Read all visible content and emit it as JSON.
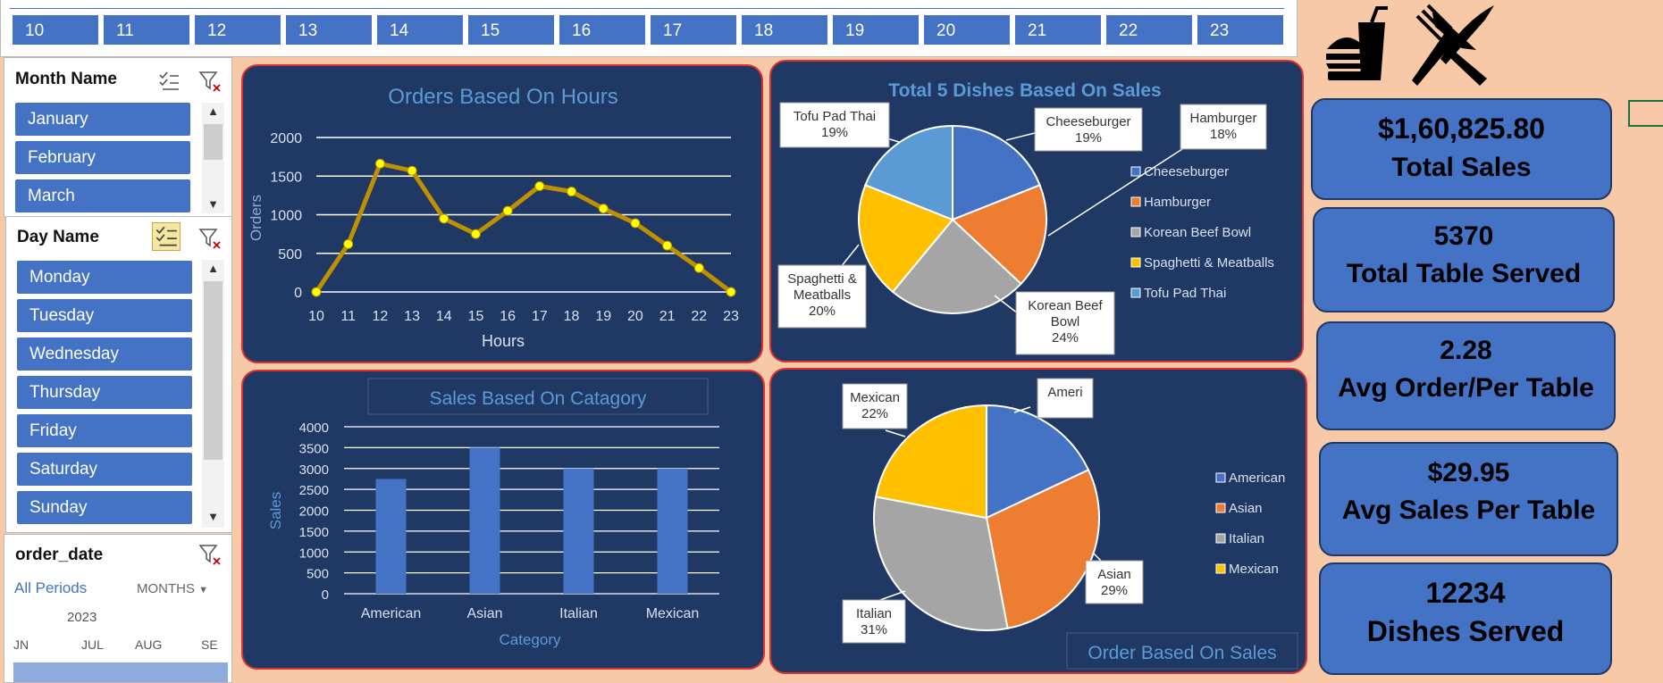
{
  "hour_slicer": {
    "hours": [
      "10",
      "11",
      "12",
      "13",
      "14",
      "15",
      "16",
      "17",
      "18",
      "19",
      "20",
      "21",
      "22",
      "23"
    ]
  },
  "month_slicer": {
    "title": "Month Name",
    "items": [
      "January",
      "February",
      "March"
    ]
  },
  "day_slicer": {
    "title": "Day Name",
    "items": [
      "Monday",
      "Tuesday",
      "Wednesday",
      "Thursday",
      "Friday",
      "Saturday",
      "Sunday"
    ]
  },
  "timeline": {
    "title": "order_date",
    "all_periods": "All Periods",
    "unit": "MONTHS",
    "year": "2023",
    "months": [
      "JN",
      "JUL",
      "AUG",
      "SE"
    ]
  },
  "kpis": [
    {
      "value": "$1,60,825.80",
      "label": "Total Sales"
    },
    {
      "value": "5370",
      "label": "Total Table Served"
    },
    {
      "value": "2.28",
      "label": "Avg Order/Per Table"
    },
    {
      "value": "$29.95",
      "label": "Avg Sales Per Table"
    },
    {
      "value": "12234",
      "label": "Dishes Served"
    }
  ],
  "colors": {
    "background": "#f8c9a6",
    "panel": "#203864",
    "panel_border": "#e03030",
    "accent": "#4472c4",
    "line": "#bf9000",
    "point": "#ffff00"
  },
  "icons": [
    "burger-drink-icon",
    "fork-knife-icon"
  ],
  "chart_data": [
    {
      "type": "line",
      "title": "Orders Based On Hours",
      "xlabel": "Hours",
      "ylabel": "Orders",
      "x": [
        10,
        11,
        12,
        13,
        14,
        15,
        16,
        17,
        18,
        19,
        20,
        21,
        22,
        23
      ],
      "y": [
        0,
        620,
        1660,
        1570,
        950,
        750,
        1050,
        1370,
        1300,
        1080,
        890,
        600,
        310,
        0
      ],
      "ylim": [
        0,
        2000
      ],
      "yticks": [
        0,
        500,
        1000,
        1500,
        2000
      ],
      "grid": true
    },
    {
      "type": "pie",
      "title": "Total 5 Dishes Based On Sales",
      "labels": [
        "Cheeseburger",
        "Hamburger",
        "Korean Beef Bowl",
        "Spaghetti & Meatballs",
        "Tofu Pad Thai"
      ],
      "values": [
        19,
        18,
        24,
        20,
        19
      ],
      "colors": [
        "#4472c4",
        "#ed7d31",
        "#a5a5a5",
        "#ffc000",
        "#5b9bd5"
      ],
      "callouts": [
        "Cheeseburger 19%",
        "Hamburger 18%",
        "Korean Beef Bowl 24%",
        "Spaghetti & Meatballs 20%",
        "Tofu Pad Thai 19%"
      ],
      "legend": "right"
    },
    {
      "type": "bar",
      "title": "Sales Based On Catagory",
      "xlabel": "Category",
      "ylabel": "Sales",
      "categories": [
        "American",
        "Asian",
        "Italian",
        "Mexican"
      ],
      "values": [
        2750,
        3500,
        3000,
        3000
      ],
      "ylim": [
        0,
        4000
      ],
      "yticks": [
        0,
        500,
        1000,
        1500,
        2000,
        2500,
        3000,
        3500,
        4000
      ],
      "grid": true
    },
    {
      "type": "pie",
      "title": "Order Based On Sales",
      "labels": [
        "American",
        "Asian",
        "Italian",
        "Mexican"
      ],
      "values": [
        18,
        29,
        31,
        22
      ],
      "colors": [
        "#4472c4",
        "#ed7d31",
        "#a5a5a5",
        "#ffc000"
      ],
      "callouts": [
        "Ameri",
        "Asian 29%",
        "Italian 31%",
        "Mexican 22%"
      ],
      "legend": "right"
    }
  ]
}
